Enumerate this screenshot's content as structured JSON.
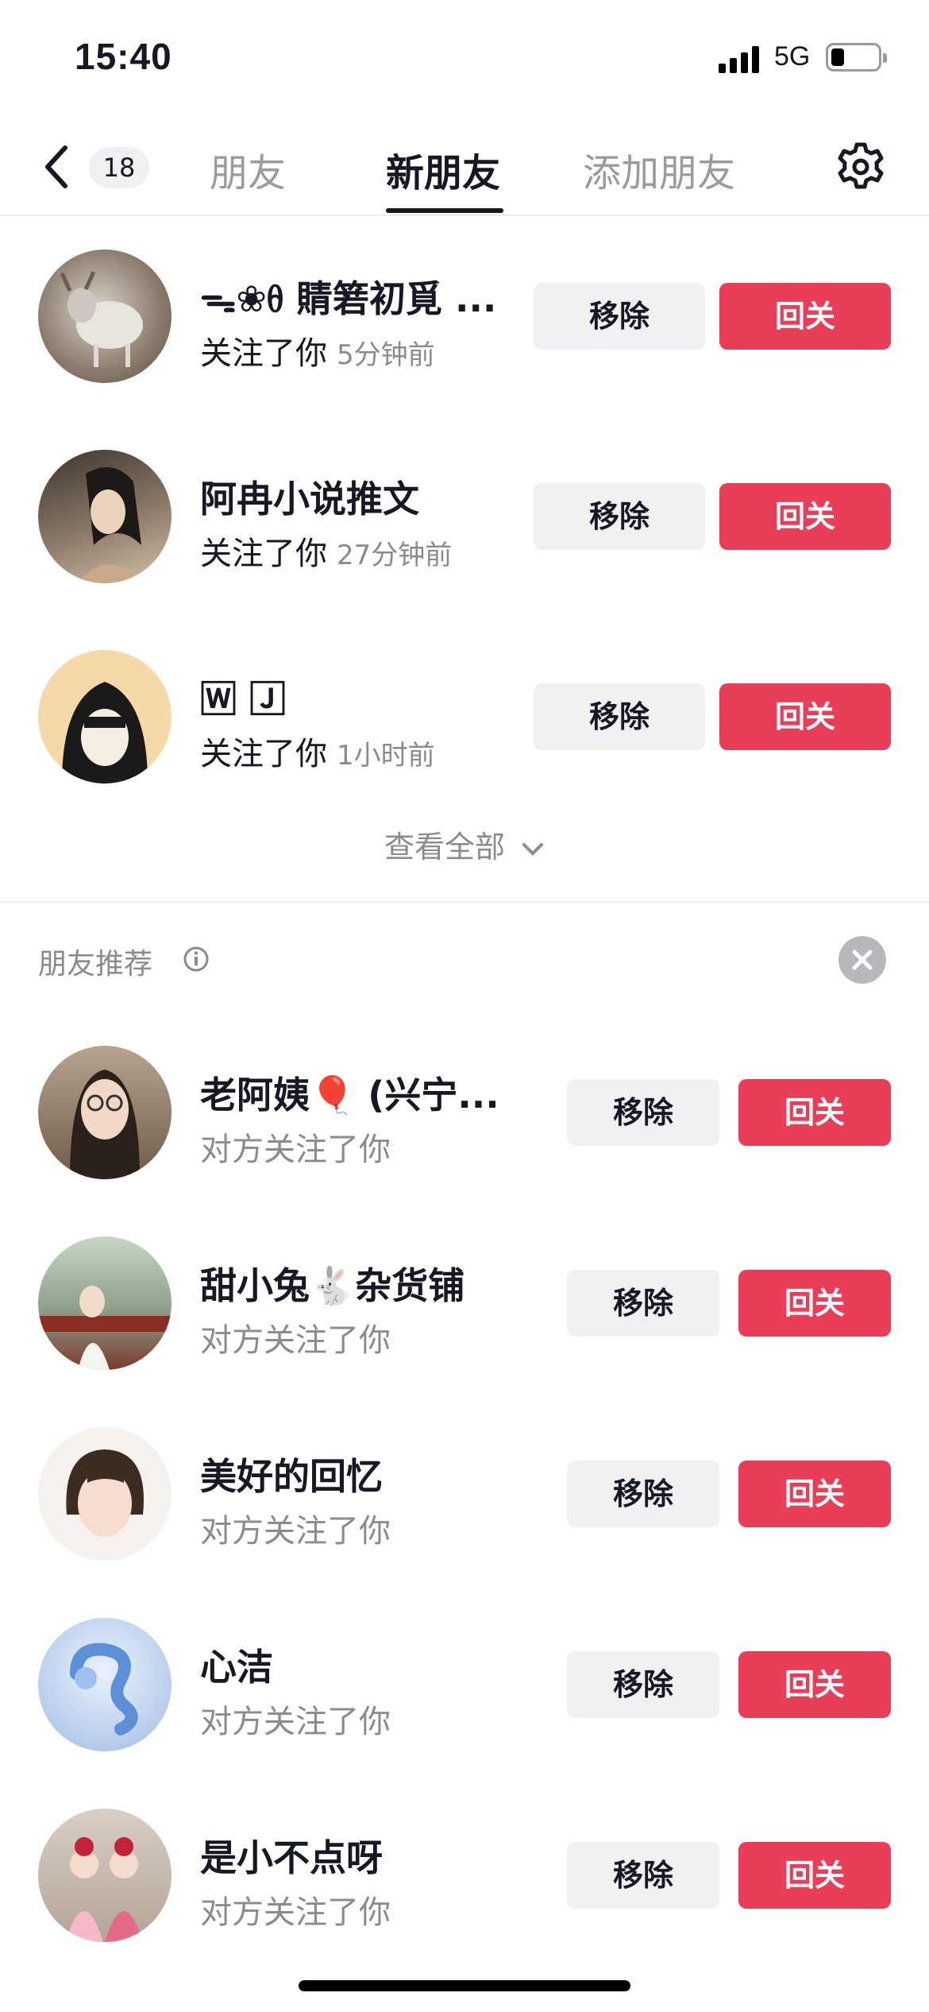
{
  "status_bar": {
    "time": "15:40",
    "network": "5G"
  },
  "header": {
    "badge_count": "18",
    "tabs": [
      {
        "label": "朋友"
      },
      {
        "label": "新朋友"
      },
      {
        "label": "添加朋友"
      }
    ],
    "active_tab": "新朋友"
  },
  "new_followers": [
    {
      "name": "ᯓ❀ᦲ 䝼箬初覓 ...",
      "action": "关注了你",
      "time": "5分钟前",
      "remove_label": "移除",
      "follow_back_label": "回关"
    },
    {
      "name": "阿冉小说推文",
      "action": "关注了你",
      "time": "27分钟前",
      "remove_label": "移除",
      "follow_back_label": "回关"
    },
    {
      "name": "🅆 🄹",
      "action": "关注了你",
      "time": "1小时前",
      "remove_label": "移除",
      "follow_back_label": "回关"
    }
  ],
  "view_all_label": "查看全部",
  "recommend": {
    "title": "朋友推荐",
    "items": [
      {
        "name": "老阿姨🎈 (兴宁...",
        "sub": "对方关注了你",
        "remove_label": "移除",
        "follow_back_label": "回关"
      },
      {
        "name": "甜小兔🐇杂货铺",
        "sub": "对方关注了你",
        "remove_label": "移除",
        "follow_back_label": "回关"
      },
      {
        "name": "美好的回忆",
        "sub": "对方关注了你",
        "remove_label": "移除",
        "follow_back_label": "回关"
      },
      {
        "name": "心洁",
        "sub": "对方关注了你",
        "remove_label": "移除",
        "follow_back_label": "回关"
      },
      {
        "name": "是小不点呀",
        "sub": "对方关注了你",
        "remove_label": "移除",
        "follow_back_label": "回关"
      }
    ]
  },
  "colors": {
    "accent": "#ea3d57",
    "button_gray": "#f1f1f3",
    "text": "#161823",
    "muted": "#8a8a90"
  }
}
